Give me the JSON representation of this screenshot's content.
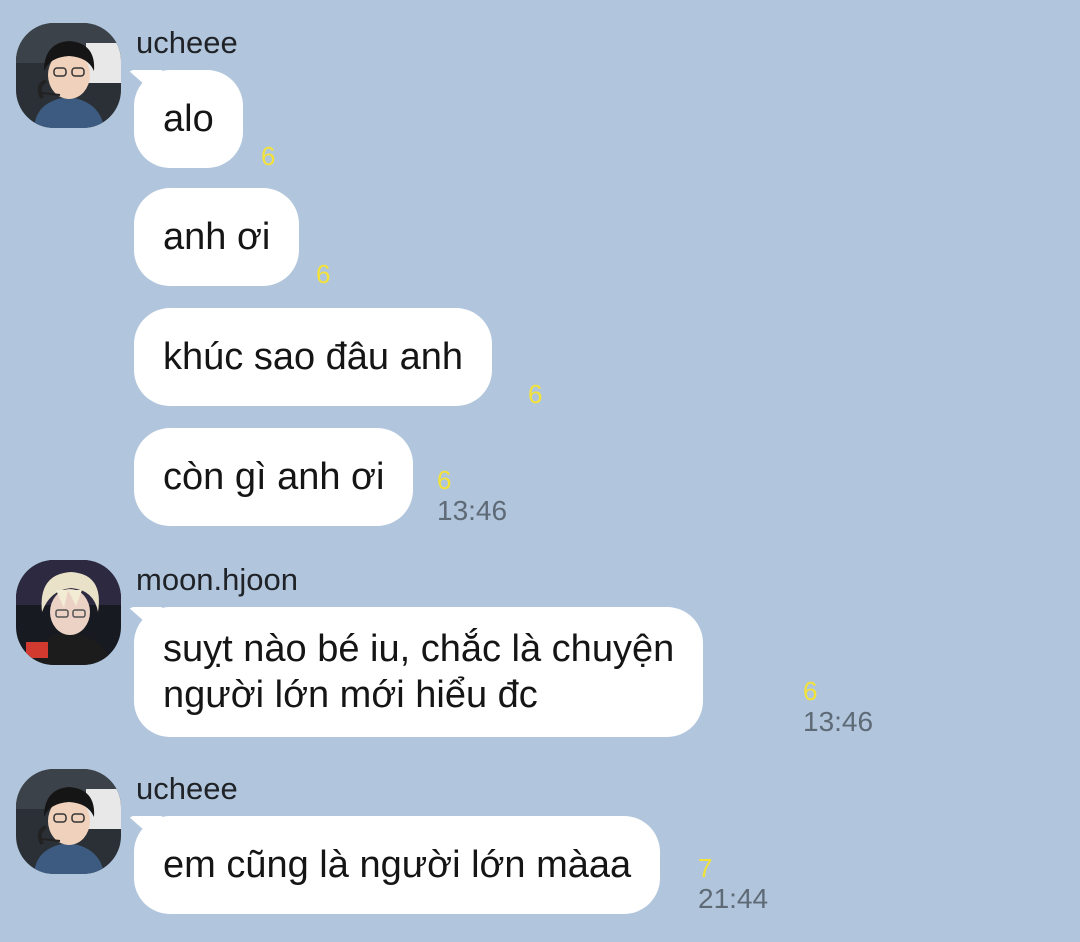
{
  "theme": {
    "background": "#b1c6dc",
    "bubble": "#ffffff",
    "unread_color": "#f2e23a",
    "time_color": "#5f6a77"
  },
  "messages": [
    {
      "sender": "ucheee",
      "avatar_icon": "user-avatar-ucheee",
      "lines": [
        {
          "text": "alo",
          "unread": "6"
        },
        {
          "text": "anh ơi",
          "unread": "6"
        },
        {
          "text": "khúc sao đâu anh",
          "unread": "6"
        },
        {
          "text": "còn gì anh ơi",
          "unread": "6",
          "time": "13:46"
        }
      ]
    },
    {
      "sender": "moon.hjoon",
      "avatar_icon": "user-avatar-moon-hjoon",
      "lines": [
        {
          "text_line_1": "suỵt nào bé iu, chắc là chuyện",
          "text_line_2": "người lớn mới hiểu đc",
          "unread": "6",
          "time": "13:46"
        }
      ]
    },
    {
      "sender": "ucheee",
      "avatar_icon": "user-avatar-ucheee",
      "lines": [
        {
          "text": "em cũng là người lớn màaa",
          "unread": "7",
          "time": "21:44"
        }
      ]
    }
  ]
}
